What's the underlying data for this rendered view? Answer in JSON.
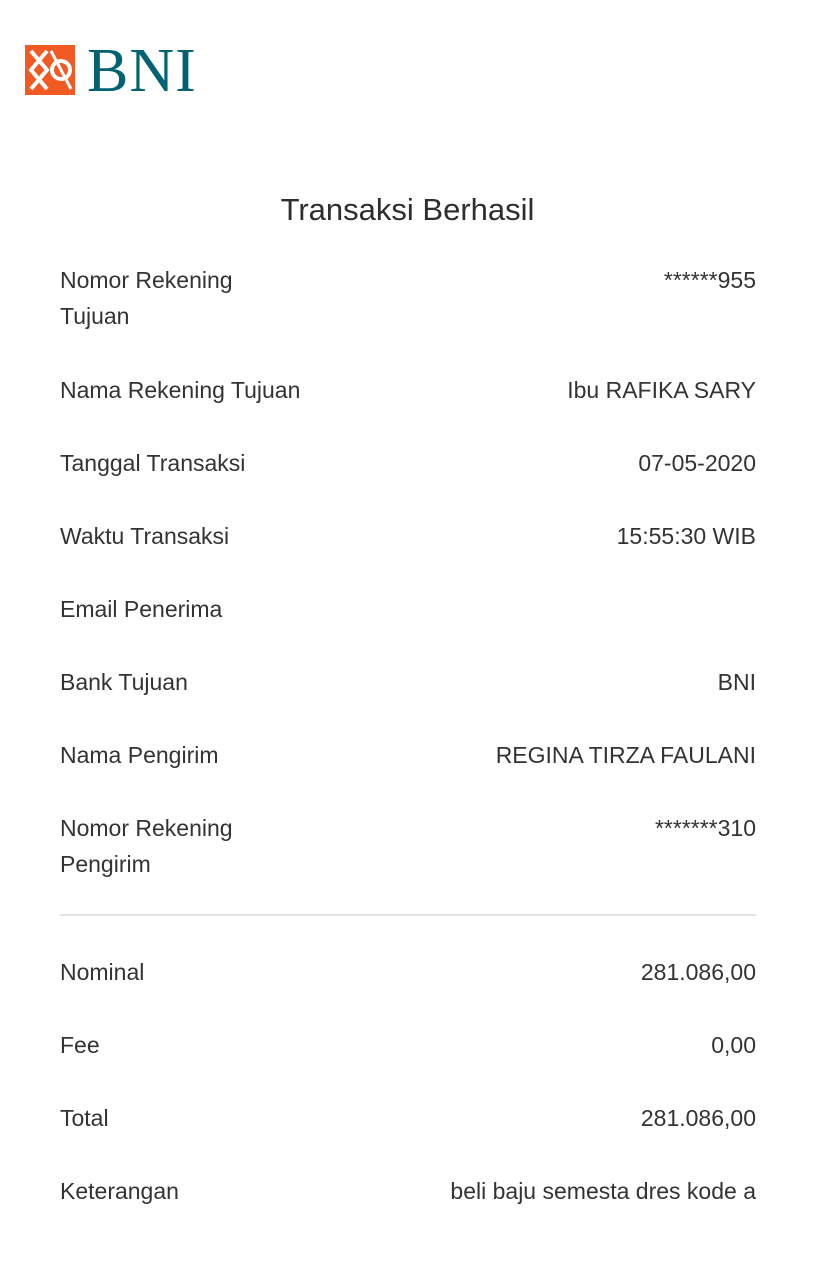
{
  "brand": {
    "logo_text": "BNI",
    "logo_mark_color": "#f15a22",
    "logo_text_color": "#006272"
  },
  "title": "Transaksi Berhasil",
  "details": [
    {
      "label": "Nomor Rekening Tujuan",
      "value": "******955"
    },
    {
      "label": "Nama Rekening Tujuan",
      "value": "Ibu RAFIKA SARY"
    },
    {
      "label": "Tanggal Transaksi",
      "value": "07-05-2020"
    },
    {
      "label": "Waktu Transaksi",
      "value": "15:55:30 WIB"
    },
    {
      "label": "Email Penerima",
      "value": ""
    },
    {
      "label": "Bank Tujuan",
      "value": "BNI"
    },
    {
      "label": "Nama Pengirim",
      "value": "REGINA TIRZA FAULANI"
    },
    {
      "label": "Nomor Rekening Pengirim",
      "value": "*******310"
    }
  ],
  "summary": [
    {
      "label": "Nominal",
      "value": "281.086,00"
    },
    {
      "label": "Fee",
      "value": "0,00"
    },
    {
      "label": "Total",
      "value": "281.086,00"
    },
    {
      "label": "Keterangan",
      "value": "beli baju semesta dres kode a"
    }
  ]
}
